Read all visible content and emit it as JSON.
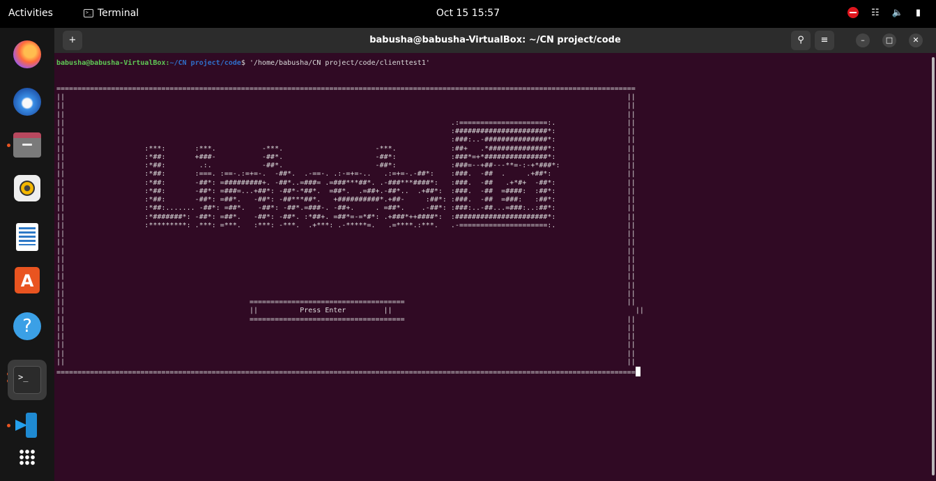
{
  "topbar": {
    "activities": "Activities",
    "app_name": "Terminal",
    "clock": "Oct 15  15:57"
  },
  "dock": {
    "items": [
      "firefox-icon",
      "thunderbird-icon",
      "files-icon",
      "rhythmbox-icon",
      "libreoffice-writer-icon",
      "app-center-icon",
      "help-icon",
      "terminal-icon",
      "vscode-icon",
      "show-apps-icon"
    ]
  },
  "window": {
    "title": "babusha@babusha-VirtualBox: ~/CN project/code"
  },
  "terminal": {
    "prompt_user": "babusha@babusha-VirtualBox",
    "prompt_path": "~/CN project/code",
    "prompt_suffix": "$ ",
    "command": "'/home/babusha/CN project/code/clienttest1'",
    "press_enter": "Press Enter"
  }
}
